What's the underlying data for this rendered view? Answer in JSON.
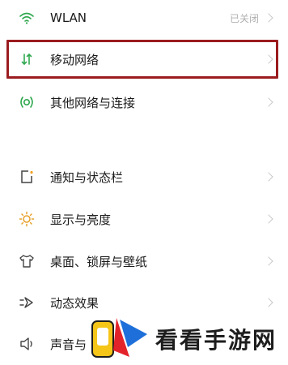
{
  "settings": {
    "rows": [
      {
        "label": "WLAN",
        "value": "已关闭",
        "icon": "wifi-icon"
      },
      {
        "label": "移动网络",
        "icon": "mobile-data-icon",
        "highlighted": true
      },
      {
        "label": "其他网络与连接",
        "icon": "connection-icon"
      },
      {
        "label": "通知与状态栏",
        "icon": "notification-icon"
      },
      {
        "label": "显示与亮度",
        "icon": "brightness-icon"
      },
      {
        "label": "桌面、锁屏与壁纸",
        "icon": "shirt-icon"
      },
      {
        "label": "动态效果",
        "icon": "dynamic-effect-icon"
      },
      {
        "label": "声音与",
        "icon": "sound-icon"
      }
    ]
  },
  "watermark": {
    "text": "看看手游网",
    "colors": {
      "yellow": "#f5c518",
      "red": "#e3232a",
      "blue": "#1e6fd9"
    }
  },
  "colors": {
    "accent_green": "#2fa84f",
    "highlight_border": "#9b1c1f"
  }
}
